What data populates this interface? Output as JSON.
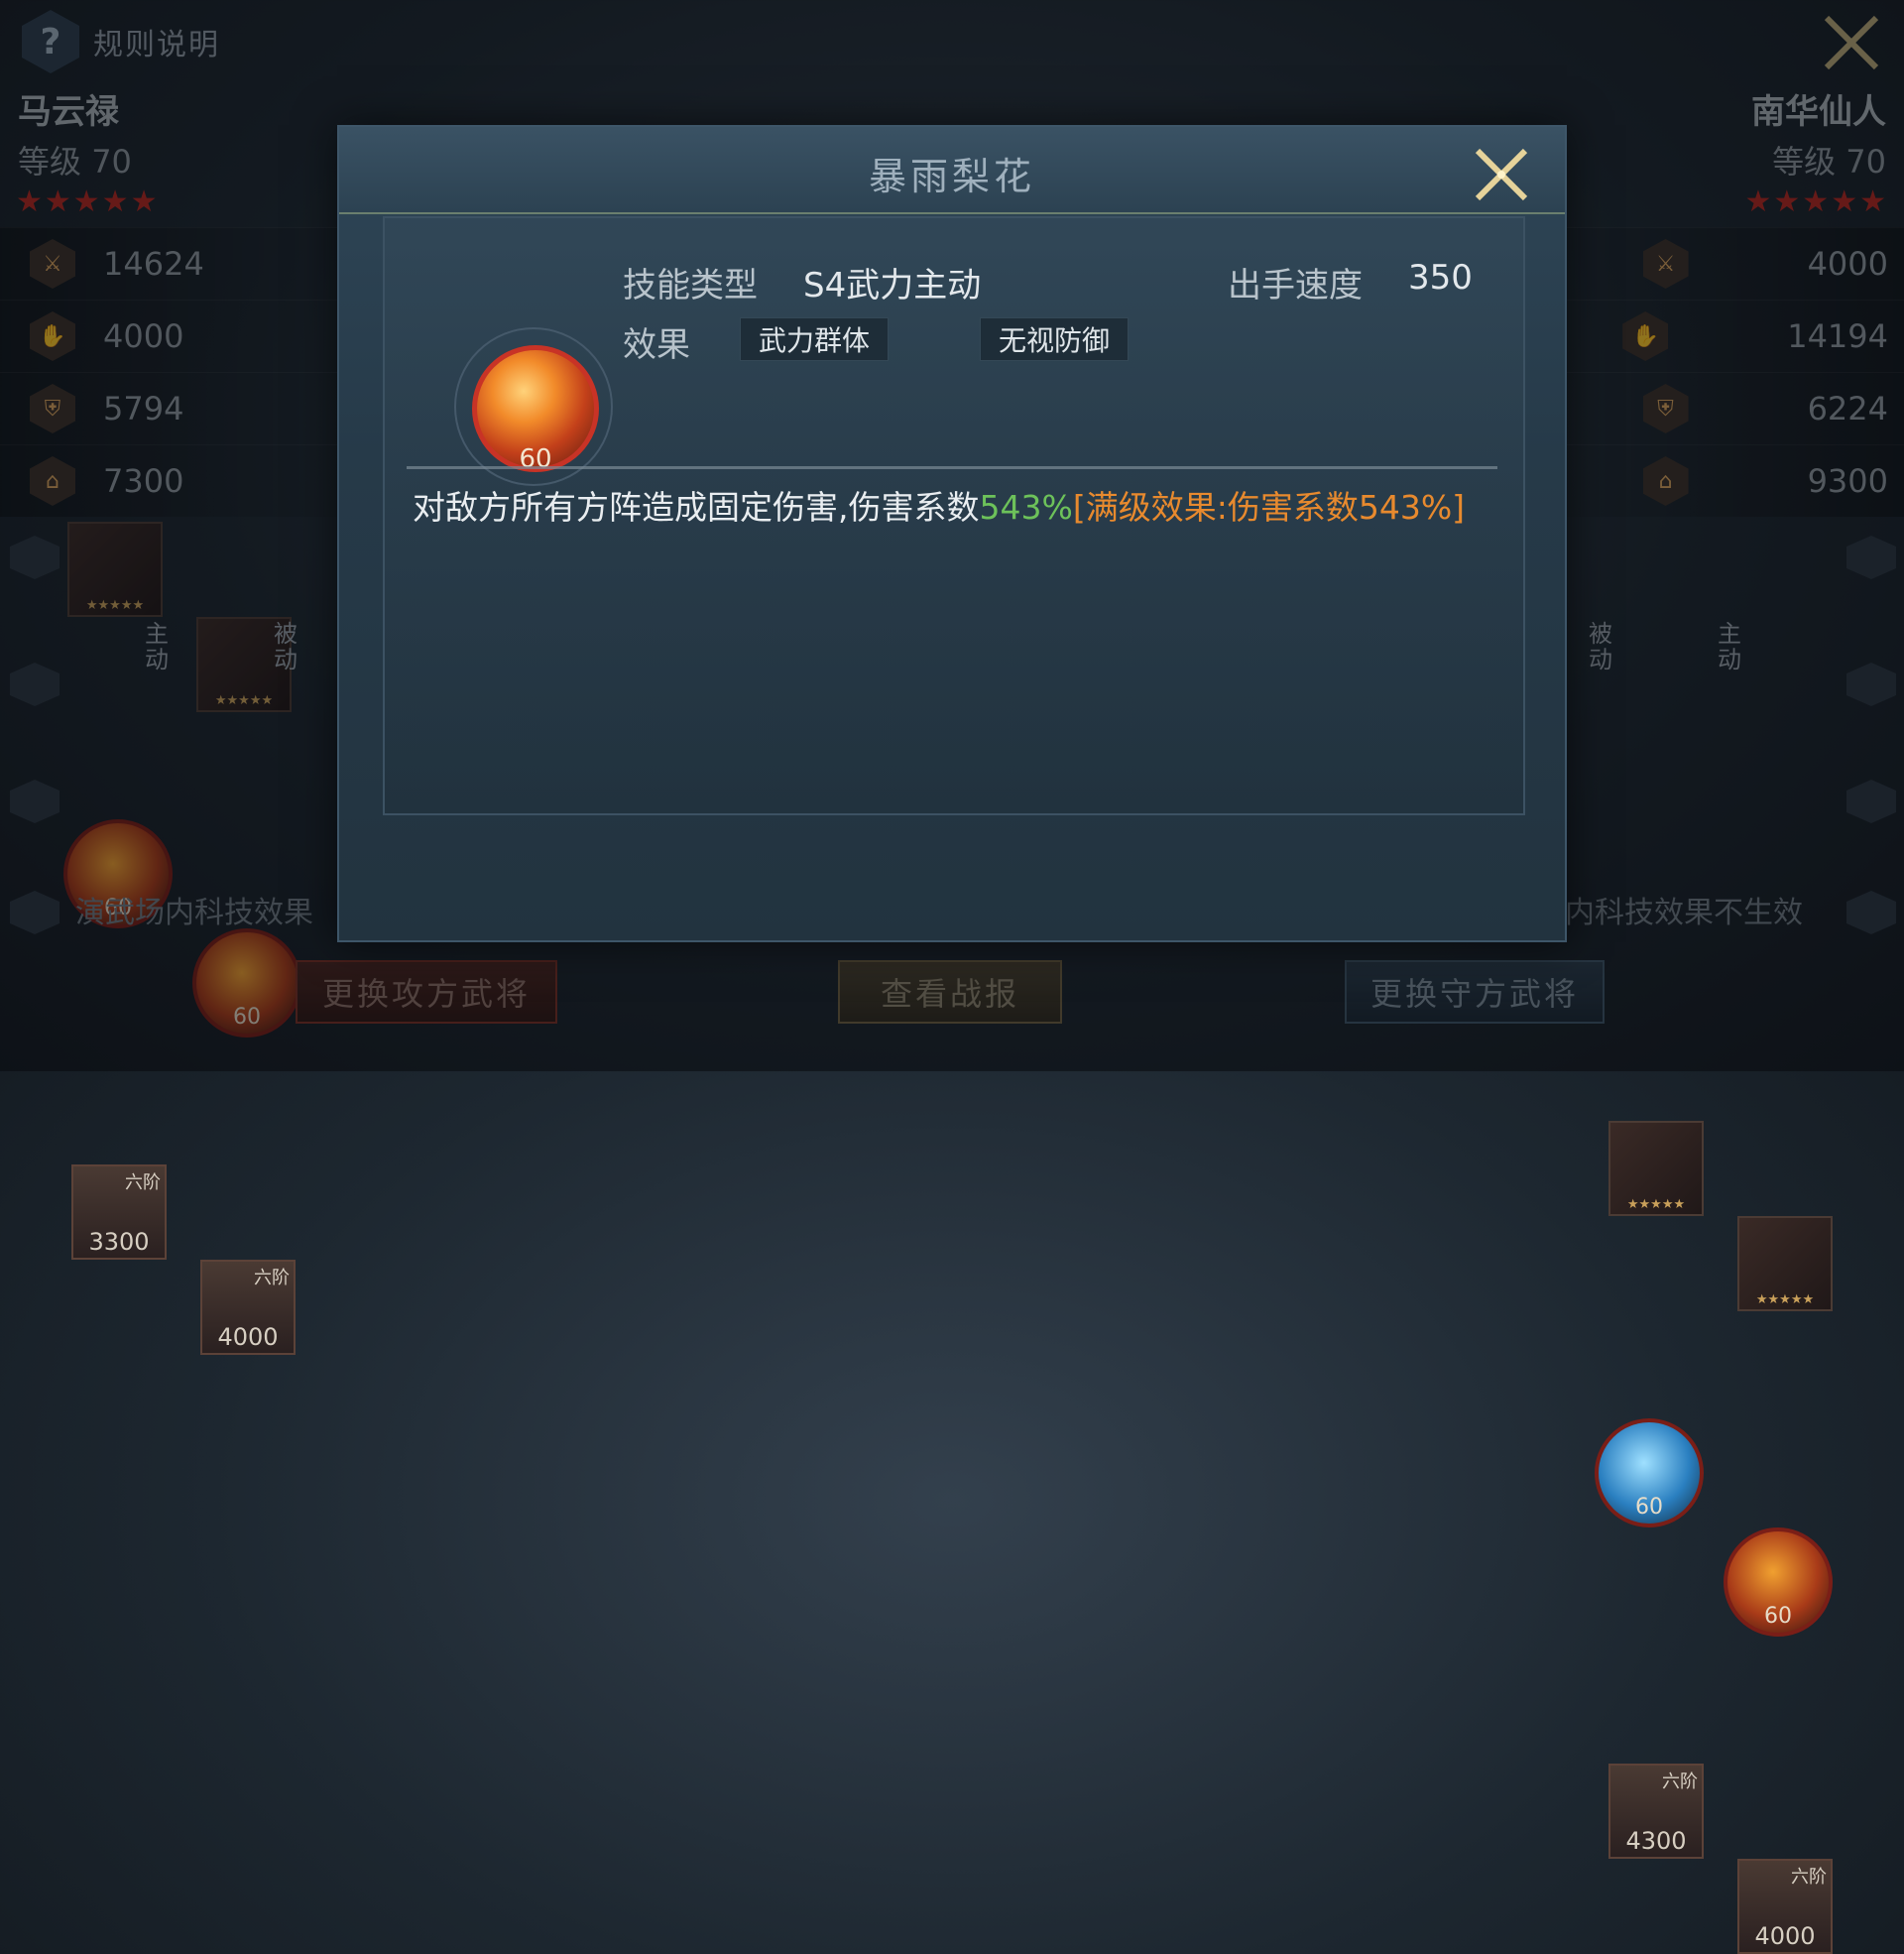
{
  "header": {
    "rules_label": "规则说明"
  },
  "attacker": {
    "name": "马云禄",
    "level_label": "等级",
    "level": "70",
    "stars": "★★★★★",
    "stats": [
      "14624",
      "4000",
      "5794",
      "7300"
    ],
    "gear_stars": "★★★★★",
    "skills": [
      {
        "tag": "主动",
        "level": "60"
      },
      {
        "tag": "被动",
        "level": "60"
      }
    ],
    "troops": [
      {
        "rank": "六阶",
        "count": "3300"
      },
      {
        "rank": "六阶",
        "count": "4000"
      }
    ],
    "tech_note": "演武场内科技效果"
  },
  "defender": {
    "name": "南华仙人",
    "level_label": "等级",
    "level": "70",
    "stars": "★★★★★",
    "stats": [
      "4000",
      "14194",
      "6224",
      "9300"
    ],
    "gear_stars": "★★★★★",
    "skills": [
      {
        "tag": "被动",
        "level": "60"
      },
      {
        "tag": "主动",
        "level": "60"
      }
    ],
    "troops": [
      {
        "rank": "六阶",
        "count": "4300"
      },
      {
        "rank": "六阶",
        "count": "4000"
      }
    ],
    "tech_note": "内科技效果不生效"
  },
  "buttons": {
    "change_attacker": "更换攻方武将",
    "view_report": "查看战报",
    "change_defender": "更换守方武将"
  },
  "modal": {
    "title": "暴雨梨花",
    "skill_level": "60",
    "type_label": "技能类型",
    "type_value": "S4武力主动",
    "speed_label": "出手速度",
    "speed_value": "350",
    "effect_label": "效果",
    "effects": [
      "武力群体",
      "无视防御"
    ],
    "desc_text": "对敌方所有方阵造成固定伤害,伤害系数",
    "desc_pct": "543%",
    "desc_full": "[满级效果:伤害系数543%]"
  }
}
